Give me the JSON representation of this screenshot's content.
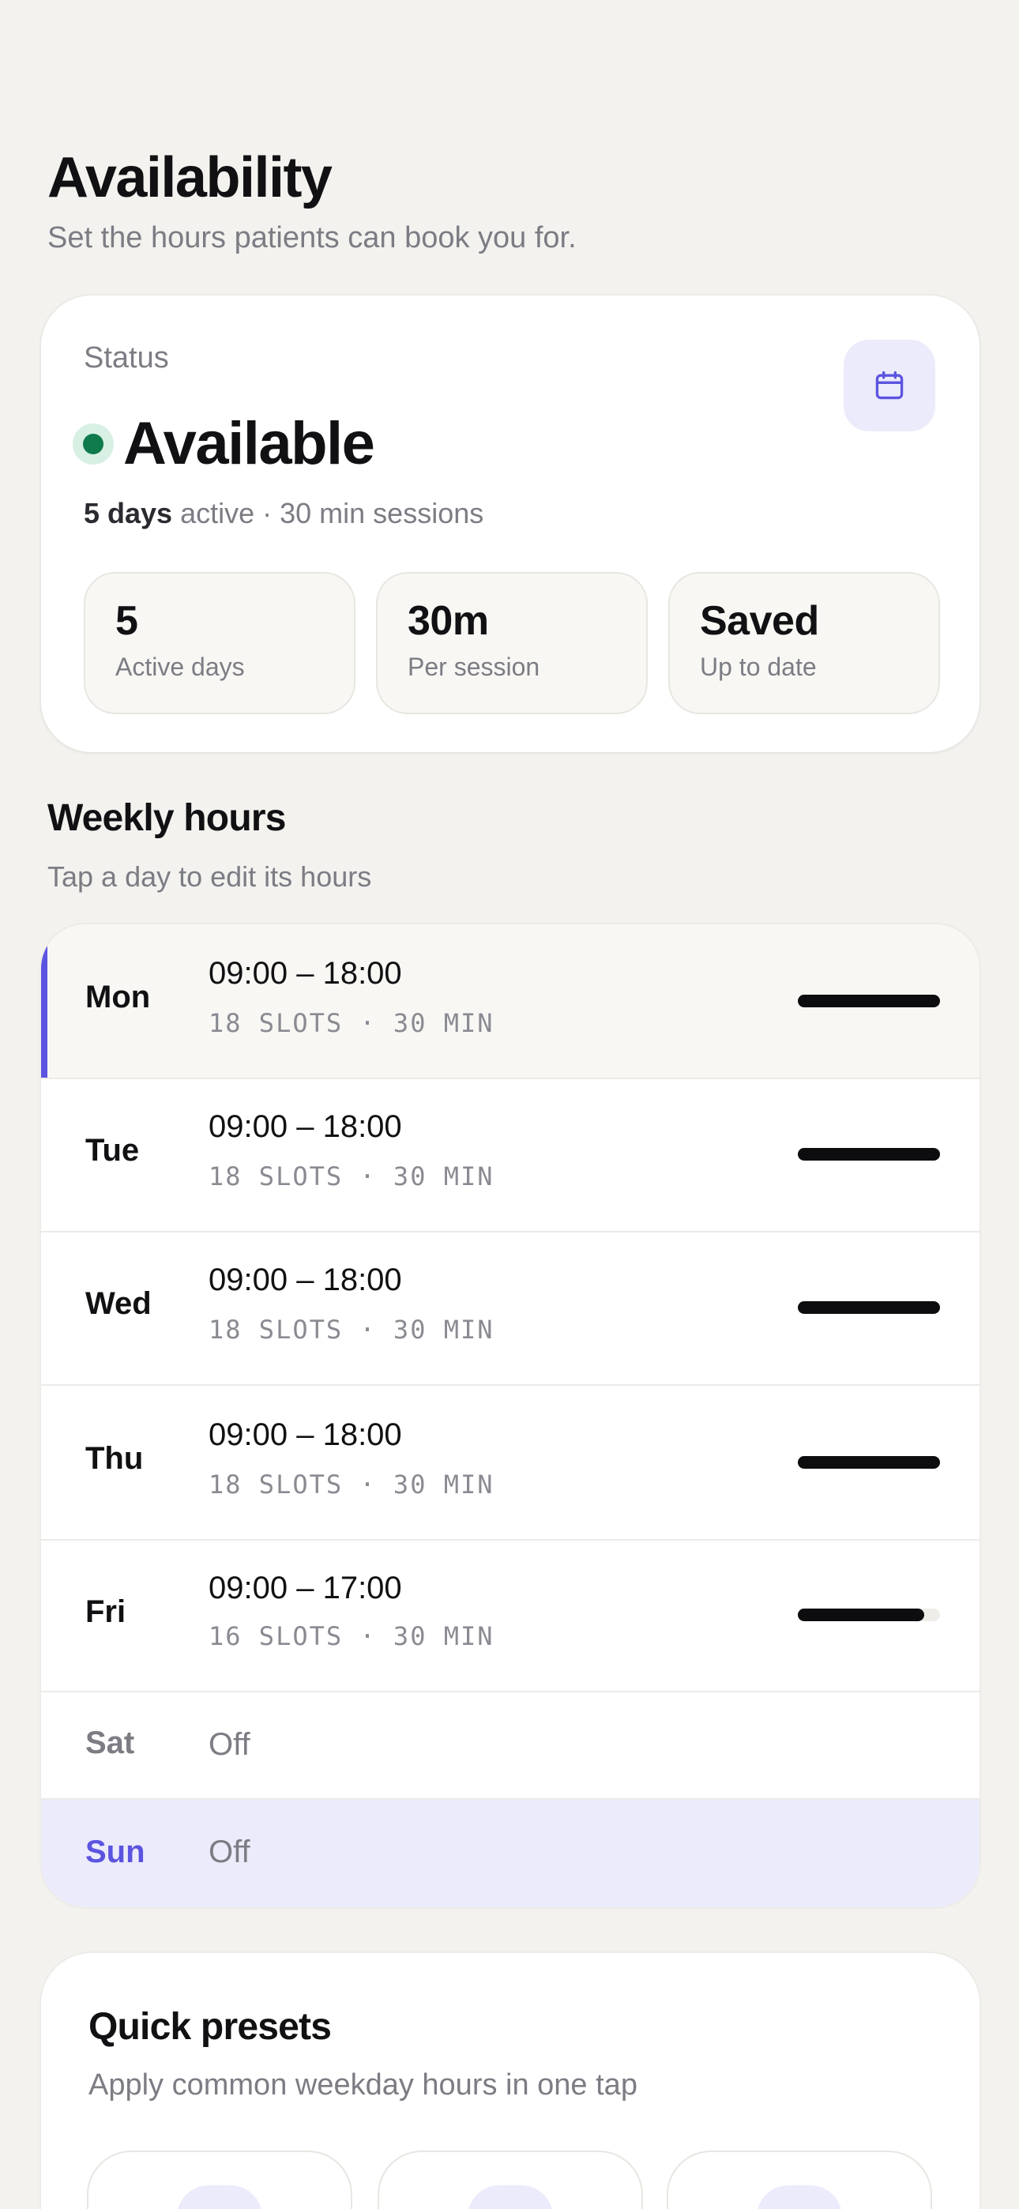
{
  "header": {
    "title": "Availability",
    "subtitle": "Set the hours patients can book you for."
  },
  "status": {
    "label": "Status",
    "value": "Available",
    "meta_bold": "5 days",
    "meta_rest": " active · 30 min sessions",
    "calendar_icon": "calendar-icon",
    "stats": [
      {
        "value": "5",
        "label": "Active days"
      },
      {
        "value": "30m",
        "label": "Per session"
      },
      {
        "value": "Saved",
        "label": "Up to date"
      }
    ]
  },
  "weekly": {
    "title": "Weekly hours",
    "subtitle": "Tap a day to edit its hours",
    "days": [
      {
        "day": "Mon",
        "hours": "09:00 – 18:00",
        "slots": "18 SLOTS · 30 MIN",
        "fill": 1.0
      },
      {
        "day": "Tue",
        "hours": "09:00 – 18:00",
        "slots": "18 SLOTS · 30 MIN",
        "fill": 1.0
      },
      {
        "day": "Wed",
        "hours": "09:00 – 18:00",
        "slots": "18 SLOTS · 30 MIN",
        "fill": 1.0
      },
      {
        "day": "Thu",
        "hours": "09:00 – 18:00",
        "slots": "18 SLOTS · 30 MIN",
        "fill": 1.0
      },
      {
        "day": "Fri",
        "hours": "09:00 – 17:00",
        "slots": "16 SLOTS · 30 MIN",
        "fill": 0.89
      },
      {
        "day": "Sat",
        "off": "Off"
      },
      {
        "day": "Sun",
        "off": "Off"
      }
    ]
  },
  "presets": {
    "title": "Quick presets",
    "subtitle": "Apply common weekday hours in one tap"
  },
  "colors": {
    "accent": "#5b54e0",
    "status_green": "#0f7a4c",
    "background": "#f3f2ef"
  }
}
